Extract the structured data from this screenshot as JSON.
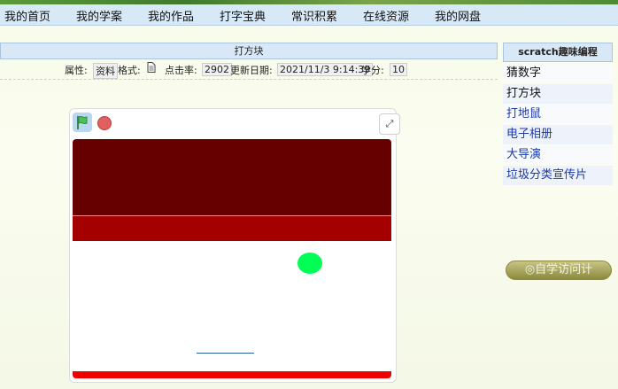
{
  "nav": {
    "items": [
      "我的首页",
      "我的学案",
      "我的作品",
      "打字宝典",
      "常识积累",
      "在线资源",
      "我的网盘"
    ]
  },
  "article": {
    "title": "打方块",
    "meta": {
      "attr_label": "属性:",
      "attr_value": "资料",
      "format_label": "格式:",
      "clicks_label": "点击率:",
      "clicks_value": "2902",
      "updated_label": "更新日期:",
      "updated_value": "2021/11/3 9:14:39",
      "credits_label": "学分:",
      "credits_value": "10"
    }
  },
  "player": {
    "icons": {
      "green_flag": "green-flag-icon",
      "stop": "stop-icon",
      "fullscreen": "fullscreen-icon"
    },
    "fullscreen_glyph": "⤢"
  },
  "sidebar": {
    "header": "scratch趣味编程",
    "items": [
      "猜数字",
      "打方块",
      "打地鼠",
      "电子相册",
      "大导演",
      "垃圾分类宣传片"
    ]
  },
  "counter": {
    "label": "◎自学访问计"
  }
}
